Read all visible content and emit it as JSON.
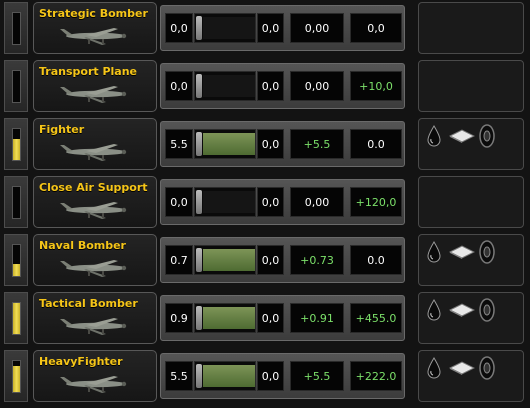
{
  "rows": [
    {
      "name": "Strategic Bomber",
      "v1": "0,0",
      "v3": "0,0",
      "v4": "0,00",
      "v5": "0,0",
      "v4_color": "white",
      "v5_color": "white",
      "fill": 0.0,
      "bar": 0.0,
      "equipment": false
    },
    {
      "name": "Transport Plane",
      "v1": "0,0",
      "v3": "0,0",
      "v4": "0,00",
      "v5": "+10,0",
      "v4_color": "white",
      "v5_color": "green",
      "fill": 0.0,
      "bar": 0.0,
      "equipment": false
    },
    {
      "name": "Fighter",
      "v1": "5.5",
      "v3": "0,0",
      "v4": "+5.5",
      "v5": "0.0",
      "v4_color": "green",
      "v5_color": "white",
      "fill": 0.67,
      "bar": 1.0,
      "equipment": true
    },
    {
      "name": "Close Air Support",
      "v1": "0,0",
      "v3": "0,0",
      "v4": "0,00",
      "v5": "+120,0",
      "v4_color": "white",
      "v5_color": "green",
      "fill": 0.0,
      "bar": 0.0,
      "equipment": false
    },
    {
      "name": "Naval Bomber",
      "v1": "0.7",
      "v3": "0,0",
      "v4": "+0.73",
      "v5": "0.0",
      "v4_color": "green",
      "v5_color": "white",
      "fill": 0.4,
      "bar": 1.0,
      "equipment": true
    },
    {
      "name": "Tactical Bomber",
      "v1": "0.9",
      "v3": "0,0",
      "v4": "+0.91",
      "v5": "+455.0",
      "v4_color": "green",
      "v5_color": "green",
      "fill": 1.0,
      "bar": 1.0,
      "equipment": true
    },
    {
      "name": "HeavyFighter",
      "v1": "5.5",
      "v3": "0,0",
      "v4": "+5.5",
      "v5": "+222.0",
      "v4_color": "green",
      "v5_color": "green",
      "fill": 0.85,
      "bar": 1.0,
      "equipment": true
    }
  ],
  "icons": {
    "unit": "aircraft-icon",
    "equipment": [
      "oil-drop-icon",
      "supply-plate-icon",
      "tire-icon"
    ]
  },
  "colors": {
    "name": "#f5c518",
    "green": "#7ce06a",
    "white": "#ffffff",
    "fill": "#f2de54"
  }
}
